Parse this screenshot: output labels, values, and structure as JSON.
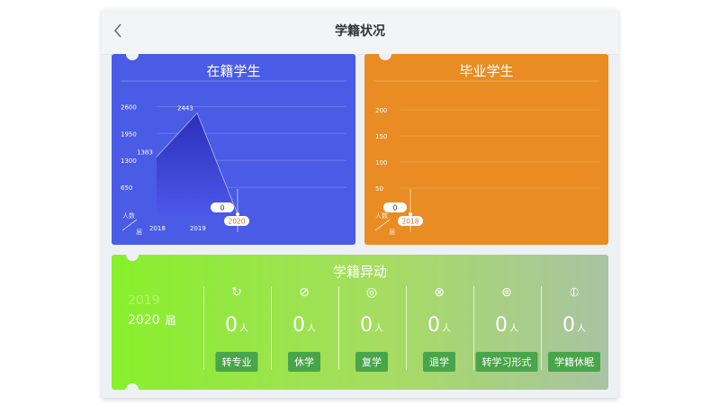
{
  "header": {
    "title": "学籍状况",
    "back_icon": "chevron-left-icon"
  },
  "cards": {
    "enrolled": {
      "title": "在籍学生",
      "badge_value": "0",
      "selected_year": "2020",
      "axis_unit_top": "人数",
      "axis_unit_bottom": "届"
    },
    "graduated": {
      "title": "毕业学生",
      "badge_value": "0",
      "selected_year": "2018",
      "axis_unit_top": "人数",
      "axis_unit_bottom": "届"
    }
  },
  "changes": {
    "title": "学籍异动",
    "years": [
      {
        "label": "2019"
      },
      {
        "label": "2020",
        "unit": "届"
      }
    ],
    "items": [
      {
        "icon": "redo-arrow-icon",
        "value": "0",
        "unit": "人",
        "label": "转专业"
      },
      {
        "icon": "slash-circle-icon",
        "value": "0",
        "unit": "人",
        "label": "休学"
      },
      {
        "icon": "refresh-circle-icon",
        "value": "0",
        "unit": "人",
        "label": "复学"
      },
      {
        "icon": "cancel-circle-icon",
        "value": "0",
        "unit": "人",
        "label": "退学"
      },
      {
        "icon": "swap-circle-icon",
        "value": "0",
        "unit": "人",
        "label": "转学习形式"
      },
      {
        "icon": "pause-circle-icon",
        "value": "0",
        "unit": "人",
        "label": "学籍休眠"
      }
    ]
  },
  "chart_data": [
    {
      "type": "area",
      "title": "在籍学生",
      "categories": [
        "2018",
        "2019",
        "2020"
      ],
      "values": [
        1383,
        2443,
        0
      ],
      "yticks": [
        650,
        1300,
        1950,
        2600
      ],
      "ylim": [
        0,
        3000
      ],
      "grid": true
    },
    {
      "type": "area",
      "title": "毕业学生",
      "categories": [
        "2018"
      ],
      "values": [
        0
      ],
      "yticks": [
        50,
        100,
        150,
        200
      ],
      "ylim": [
        0,
        200
      ],
      "grid": true
    }
  ]
}
